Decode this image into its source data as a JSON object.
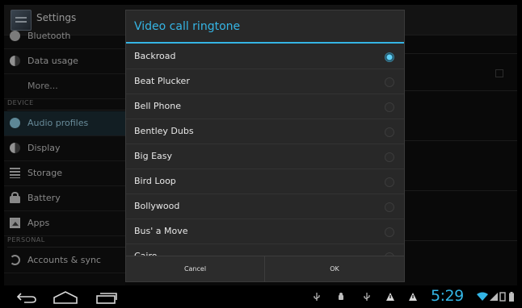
{
  "app": {
    "title": "Settings"
  },
  "sidebar": {
    "items": [
      {
        "label": "Bluetooth",
        "icon": "bluetooth-icon"
      },
      {
        "label": "Data usage",
        "icon": "data-usage-icon"
      },
      {
        "label": "More...",
        "icon": ""
      },
      {
        "label": "Audio profiles",
        "icon": "audio-profiles-icon",
        "selected": true
      },
      {
        "label": "Display",
        "icon": "display-icon"
      },
      {
        "label": "Storage",
        "icon": "storage-icon"
      },
      {
        "label": "Battery",
        "icon": "battery-icon"
      },
      {
        "label": "Apps",
        "icon": "apps-icon"
      },
      {
        "label": "Accounts & sync",
        "icon": "accounts-sync-icon"
      }
    ],
    "headers": {
      "device": "DEVICE",
      "personal": "PERSONAL"
    }
  },
  "dialog": {
    "title": "Video call ringtone",
    "selected_index": 0,
    "items": [
      "Backroad",
      "Beat Plucker",
      "Bell Phone",
      "Bentley Dubs",
      "Big Easy",
      "Bird Loop",
      "Bollywood",
      "Bus' a Move",
      "Cairo"
    ],
    "buttons": {
      "cancel": "Cancel",
      "ok": "OK"
    }
  },
  "status_bar": {
    "time": "5:29",
    "accent_color": "#33b5e5",
    "icons": [
      "usb-icon",
      "android-debug-icon",
      "usb-icon",
      "warning-icon",
      "warning-icon",
      "wifi-icon",
      "signal-icon",
      "sim-icon",
      "battery-icon"
    ]
  },
  "colors": {
    "accent": "#35b5e5",
    "dialog_bg": "#282828",
    "selected_row": "#1d2f37"
  }
}
